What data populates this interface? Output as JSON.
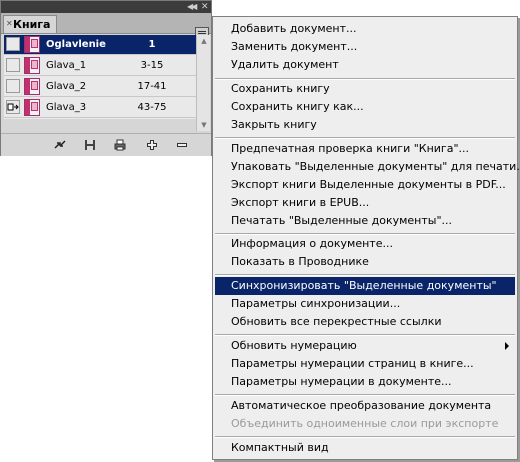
{
  "panel": {
    "tab_label": "Книга",
    "documents": [
      {
        "name": "Oglavlenie",
        "pages": "1",
        "selected": true,
        "status": ""
      },
      {
        "name": "Glava_1",
        "pages": "3-15",
        "selected": false,
        "status": ""
      },
      {
        "name": "Glava_2",
        "pages": "17-41",
        "selected": false,
        "status": ""
      },
      {
        "name": "Glava_3",
        "pages": "43-75",
        "selected": false,
        "status": "sync-source-icon"
      }
    ],
    "bottom_buttons": [
      "sync-icon",
      "save-icon",
      "print-icon",
      "add-document-icon",
      "remove-document-icon"
    ]
  },
  "menu": {
    "groups": [
      [
        "Добавить документ...",
        "Заменить документ...",
        "Удалить документ"
      ],
      [
        "Сохранить книгу",
        "Сохранить книгу как...",
        "Закрыть книгу"
      ],
      [
        "Предпечатная проверка книги \"Книга\"...",
        "Упаковать \"Выделенные документы\" для печати...",
        "Экспорт книги Выделенные документы в PDF...",
        "Экспорт книги в EPUB...",
        "Печатать \"Выделенные документы\"..."
      ],
      [
        "Информация о документе...",
        "Показать в Проводнике"
      ],
      [
        "Синхронизировать \"Выделенные документы\"",
        "Параметры синхронизации...",
        "Обновить все перекрестные ссылки"
      ],
      [
        "Обновить нумерацию",
        "Параметры нумерации страниц в книге...",
        "Параметры нумерации в документе..."
      ],
      [
        "Автоматическое преобразование документа",
        "Объединить одноименные слои при экспорте"
      ],
      [
        "Компактный вид"
      ]
    ],
    "highlighted": "Синхронизировать \"Выделенные документы\"",
    "disabled": [
      "Объединить одноименные слои при экспорте"
    ],
    "submenu": [
      "Обновить нумерацию"
    ]
  },
  "colors": {
    "selection": "#0a246a",
    "menu_bg": "#eeeeee",
    "panel_bg": "#d6d6d6"
  }
}
